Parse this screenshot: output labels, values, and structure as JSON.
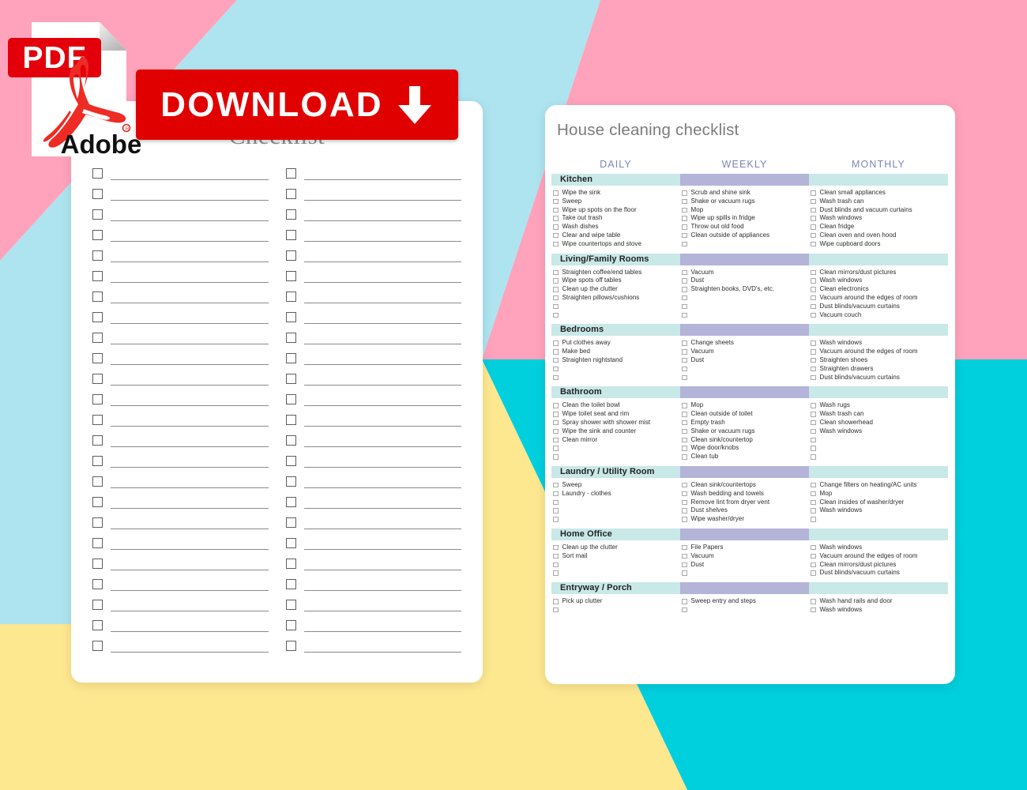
{
  "background": {
    "pink": "#FFA3BC",
    "light_blue": "#ADE4EF",
    "yellow": "#FDE78F",
    "cyan": "#00CFDE",
    "white": "#FFFFFF"
  },
  "pdf_badge": {
    "format_label": "PDF",
    "brand_label": "Adobe",
    "icon": "adobe-pdf-icon",
    "red": "#E3000B"
  },
  "download_button": {
    "label": "DOWNLOAD",
    "icon": "download-arrow-icon",
    "color": "#E00000"
  },
  "left_card": {
    "title": "Checklist",
    "rows": 24,
    "columns": 2
  },
  "right_card": {
    "title": "House cleaning checklist",
    "column_headers": [
      "DAILY",
      "WEEKLY",
      "MONTHLY"
    ],
    "colors": {
      "section_bar_teal": "#C9E8E8",
      "section_bar_purple": "#B4B3D8",
      "header_text": "#7B86B5"
    },
    "sections": [
      {
        "name": "Kitchen",
        "daily": [
          "Wipe the sink",
          "Sweep",
          "Wipe up spots on the floor",
          "Take out trash",
          "Wash dishes",
          "Clear and wipe table",
          "Wipe countertops and stove"
        ],
        "weekly": [
          "Scrub and shine sink",
          "Shake or vacuum rugs",
          "Mop",
          "Wipe up spills in fridge",
          "Throw out old food",
          "Clean outside of appliances",
          ""
        ],
        "monthly": [
          "Clean small appliances",
          "Wash trash can",
          "Dust blinds and vacuum curtains",
          "Wash windows",
          "Clean fridge",
          "Clean oven and oven hood",
          "Wipe cupboard doors"
        ]
      },
      {
        "name": "Living/Family Rooms",
        "daily": [
          "Straighten coffee/end tables",
          "Wipe spots off tables",
          "Clean up the clutter",
          "Straighten pillows/cushions",
          "",
          ""
        ],
        "weekly": [
          "Vacuum",
          "Dust",
          "Straighten books, DVD's, etc.",
          "",
          "",
          ""
        ],
        "monthly": [
          "Clean mirrors/dust pictures",
          "Wash windows",
          "Clean electronics",
          "Vacuum around the edges of room",
          "Dust blinds/vacuum curtains",
          "Vacuum couch"
        ]
      },
      {
        "name": "Bedrooms",
        "daily": [
          "Put clothes away",
          "Make bed",
          "Straighten nightstand",
          "",
          ""
        ],
        "weekly": [
          "Change sheets",
          "Vacuum",
          "Dust",
          "",
          ""
        ],
        "monthly": [
          "Wash windows",
          "Vacuum around the edges of room",
          "Straighten shoes",
          "Straighten drawers",
          "Dust blinds/vacuum curtains"
        ]
      },
      {
        "name": "Bathroom",
        "daily": [
          "Clean the toilet bowl",
          "Wipe toilet seat and rim",
          "Spray shower with shower mist",
          "Wipe the sink and counter",
          "Clean mirror",
          "",
          ""
        ],
        "weekly": [
          "Mop",
          "Clean outside of toilet",
          "Empty trash",
          "Shake or vacuum rugs",
          "Clean sink/countertop",
          "Wipe door/knobs",
          "Clean tub"
        ],
        "monthly": [
          "Wash rugs",
          "Wash trash can",
          "Clean showerhead",
          "Wash windows",
          "",
          "",
          ""
        ]
      },
      {
        "name": "Laundry / Utility Room",
        "daily": [
          "Sweep",
          "Laundry - clothes",
          "",
          "",
          ""
        ],
        "weekly": [
          "Clean sink/countertops",
          "Wash bedding and towels",
          "Remove lint from dryer vent",
          "Dust shelves",
          "Wipe washer/dryer"
        ],
        "monthly": [
          "Change filters on heating/AC units",
          "Mop",
          "Clean insides of washer/dryer",
          "Wash windows",
          ""
        ]
      },
      {
        "name": "Home Office",
        "daily": [
          "Clean up the clutter",
          "Sort mail",
          "",
          ""
        ],
        "weekly": [
          "File Papers",
          "Vacuum",
          "Dust",
          ""
        ],
        "monthly": [
          "Wash windows",
          "Vacuum around the edges of room",
          "Clean mirrors/dust pictures",
          "Dust blinds/vacuum curtains"
        ]
      },
      {
        "name": "Entryway / Porch",
        "daily": [
          "Pick up clutter",
          ""
        ],
        "weekly": [
          "Sweep entry and steps",
          ""
        ],
        "monthly": [
          "Wash hand rails and door",
          "Wash windows"
        ]
      }
    ]
  }
}
